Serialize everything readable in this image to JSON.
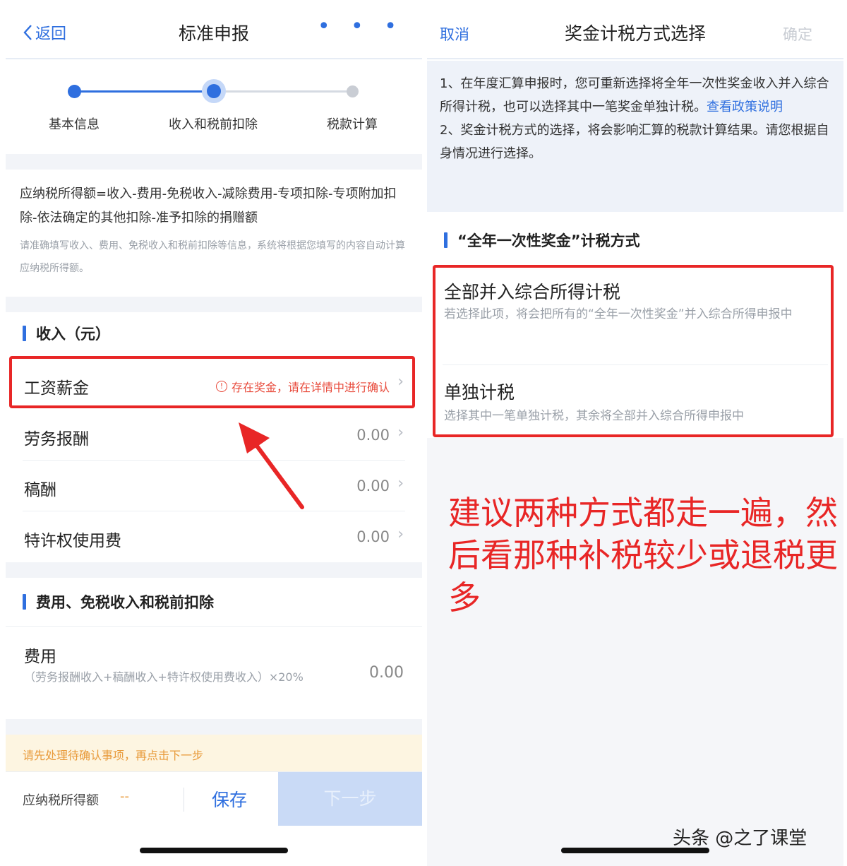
{
  "left": {
    "nav": {
      "back_label": "返回",
      "title": "标准申报",
      "more": "• • •"
    },
    "steps": [
      "基本信息",
      "收入和税前扣除",
      "税款计算"
    ],
    "formula": {
      "main": "应纳税所得额=收入-费用-免税收入-减除费用-专项扣除-专项附加扣除-依法确定的其他扣除-准予扣除的捐赠额",
      "sub": "请准确填写收入、费用、免税收入和税前扣除等信息，系统将根据您填写的内容自动计算应纳税所得额。"
    },
    "income_section": "收入（元）",
    "income_rows": [
      {
        "label": "工资薪金",
        "warning": "存在奖金，请在详情中进行确认"
      },
      {
        "label": "劳务报酬",
        "value": "0.00"
      },
      {
        "label": "稿酬",
        "value": "0.00"
      },
      {
        "label": "特许权使用费",
        "value": "0.00"
      }
    ],
    "deduction_section": "费用、免税收入和税前扣除",
    "fee": {
      "label": "费用",
      "note": "（劳务报酬收入+稿酬收入+特许权使用费收入）×20%",
      "value": "0.00"
    },
    "notice": "请先处理待确认事项，再点击下一步",
    "bottom": {
      "tax_label": "应纳税所得额",
      "tax_value": "--",
      "save": "保存",
      "next": "下一步"
    }
  },
  "right": {
    "nav": {
      "cancel": "取消",
      "title": "奖金计税方式选择",
      "confirm": "确定"
    },
    "info": {
      "p1": "1、在年度汇算申报时，您可重新选择将全年一次性奖金收入并入综合所得计税，也可以选择其中一笔奖金单独计税。",
      "link": "查看政策说明",
      "p2": "2、奖金计税方式的选择，将会影响汇算的税款计算结果。请您根据自身情况进行选择。"
    },
    "section_title": "“全年一次性奖金”计税方式",
    "options": [
      {
        "title": "全部并入综合所得计税",
        "desc": "若选择此项，将会把所有的“全年一次性奖金”并入综合所得申报中"
      },
      {
        "title": "单独计税",
        "desc": "选择其中一笔单独计税，其余将全部并入综合所得申报中"
      }
    ],
    "advice": "建议两种方式都走一遍，然后看那种补税较少或退税更多",
    "watermark": "头条 @之了课堂"
  },
  "colors": {
    "accent": "#2f6fdf",
    "annotation_red": "#e82626",
    "warning": "#e84a3b"
  }
}
